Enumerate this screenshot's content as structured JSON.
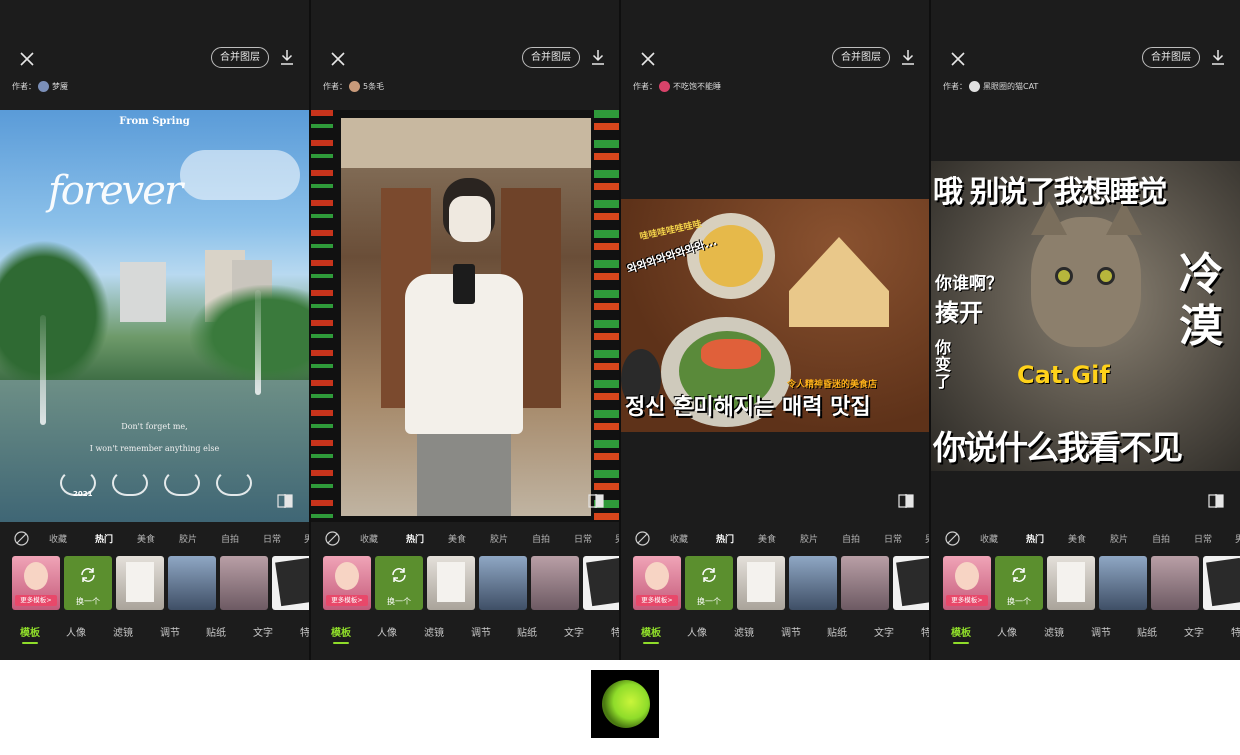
{
  "toolbar": {
    "merge_label": "合并图层"
  },
  "author_prefix": "作者：",
  "authors": [
    "梦魇",
    "5条毛",
    "不吃饱不能睡",
    "黑眼圈的猫CAT"
  ],
  "categories": [
    "收藏",
    "热门",
    "美食",
    "胶片",
    "自拍",
    "日常",
    "男"
  ],
  "active_category": "热门",
  "more_templates_label": "更多模板>",
  "swap_label": "换一个",
  "tools": [
    "模板",
    "人像",
    "滤镜",
    "调节",
    "贴纸",
    "文字",
    "特"
  ],
  "active_tool": "模板",
  "panel1": {
    "heading": "From Spring",
    "script_word": "forever",
    "line1": "Don't forget me,",
    "line2": "I won't remember anything else",
    "year": "2021"
  },
  "panel3": {
    "title_text": "정신 혼미해지는 매력 맛집",
    "subtitle_text": "令人精神昏迷的美食店",
    "wow_text": "와와와와와와와와...",
    "wow_text2": "哇哇哇哇哇哇哇"
  },
  "panel4": {
    "top": "哦 别说了我想睡觉",
    "left1": "你谁啊？",
    "left2": "揍开",
    "left3": "你变了",
    "right": "冷漠",
    "cat_gif": "Cat.Gif",
    "bottom": "你说什么我看不见"
  },
  "colors": {
    "accent": "#8fdc2a",
    "badge": "#e8486a",
    "panel_bg": "#1c1c1c"
  },
  "icons": [
    "close-icon",
    "download-icon",
    "compare-icon",
    "none-icon",
    "refresh-icon",
    "app-logo-icon"
  ]
}
